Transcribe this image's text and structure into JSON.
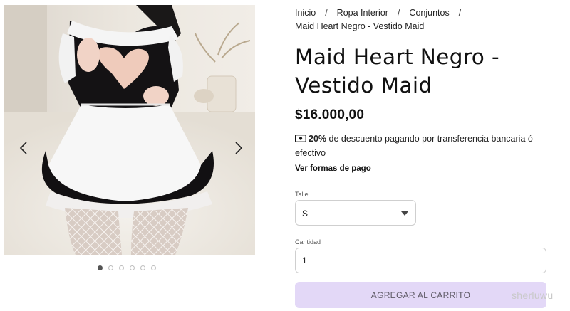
{
  "breadcrumb": {
    "items": [
      "Inicio",
      "Ropa Interior",
      "Conjuntos"
    ],
    "separator": "/",
    "current": "Maid Heart Negro - Vestido Maid"
  },
  "product": {
    "title": "Maid Heart Negro - Vestido Maid",
    "price": "$16.000,00",
    "discount_percent": "20%",
    "discount_text": " de descuento pagando por transferencia bancaria ó efectivo",
    "payment_link": "Ver formas de pago"
  },
  "size": {
    "label": "Talle",
    "value": "S"
  },
  "quantity": {
    "label": "Cantidad",
    "value": "1"
  },
  "cart_button": "AGREGAR AL CARRITO",
  "gallery": {
    "image_count": 6,
    "active_index": 0
  },
  "icons": {
    "prev": "chevron-left-icon",
    "next": "chevron-right-icon",
    "cash": "cash-icon",
    "select": "chevron-down-icon"
  },
  "colors": {
    "cart_button_bg": "#e3d8f7",
    "text": "#111111",
    "active_dot": "#555555"
  },
  "watermark": "sherluwu"
}
